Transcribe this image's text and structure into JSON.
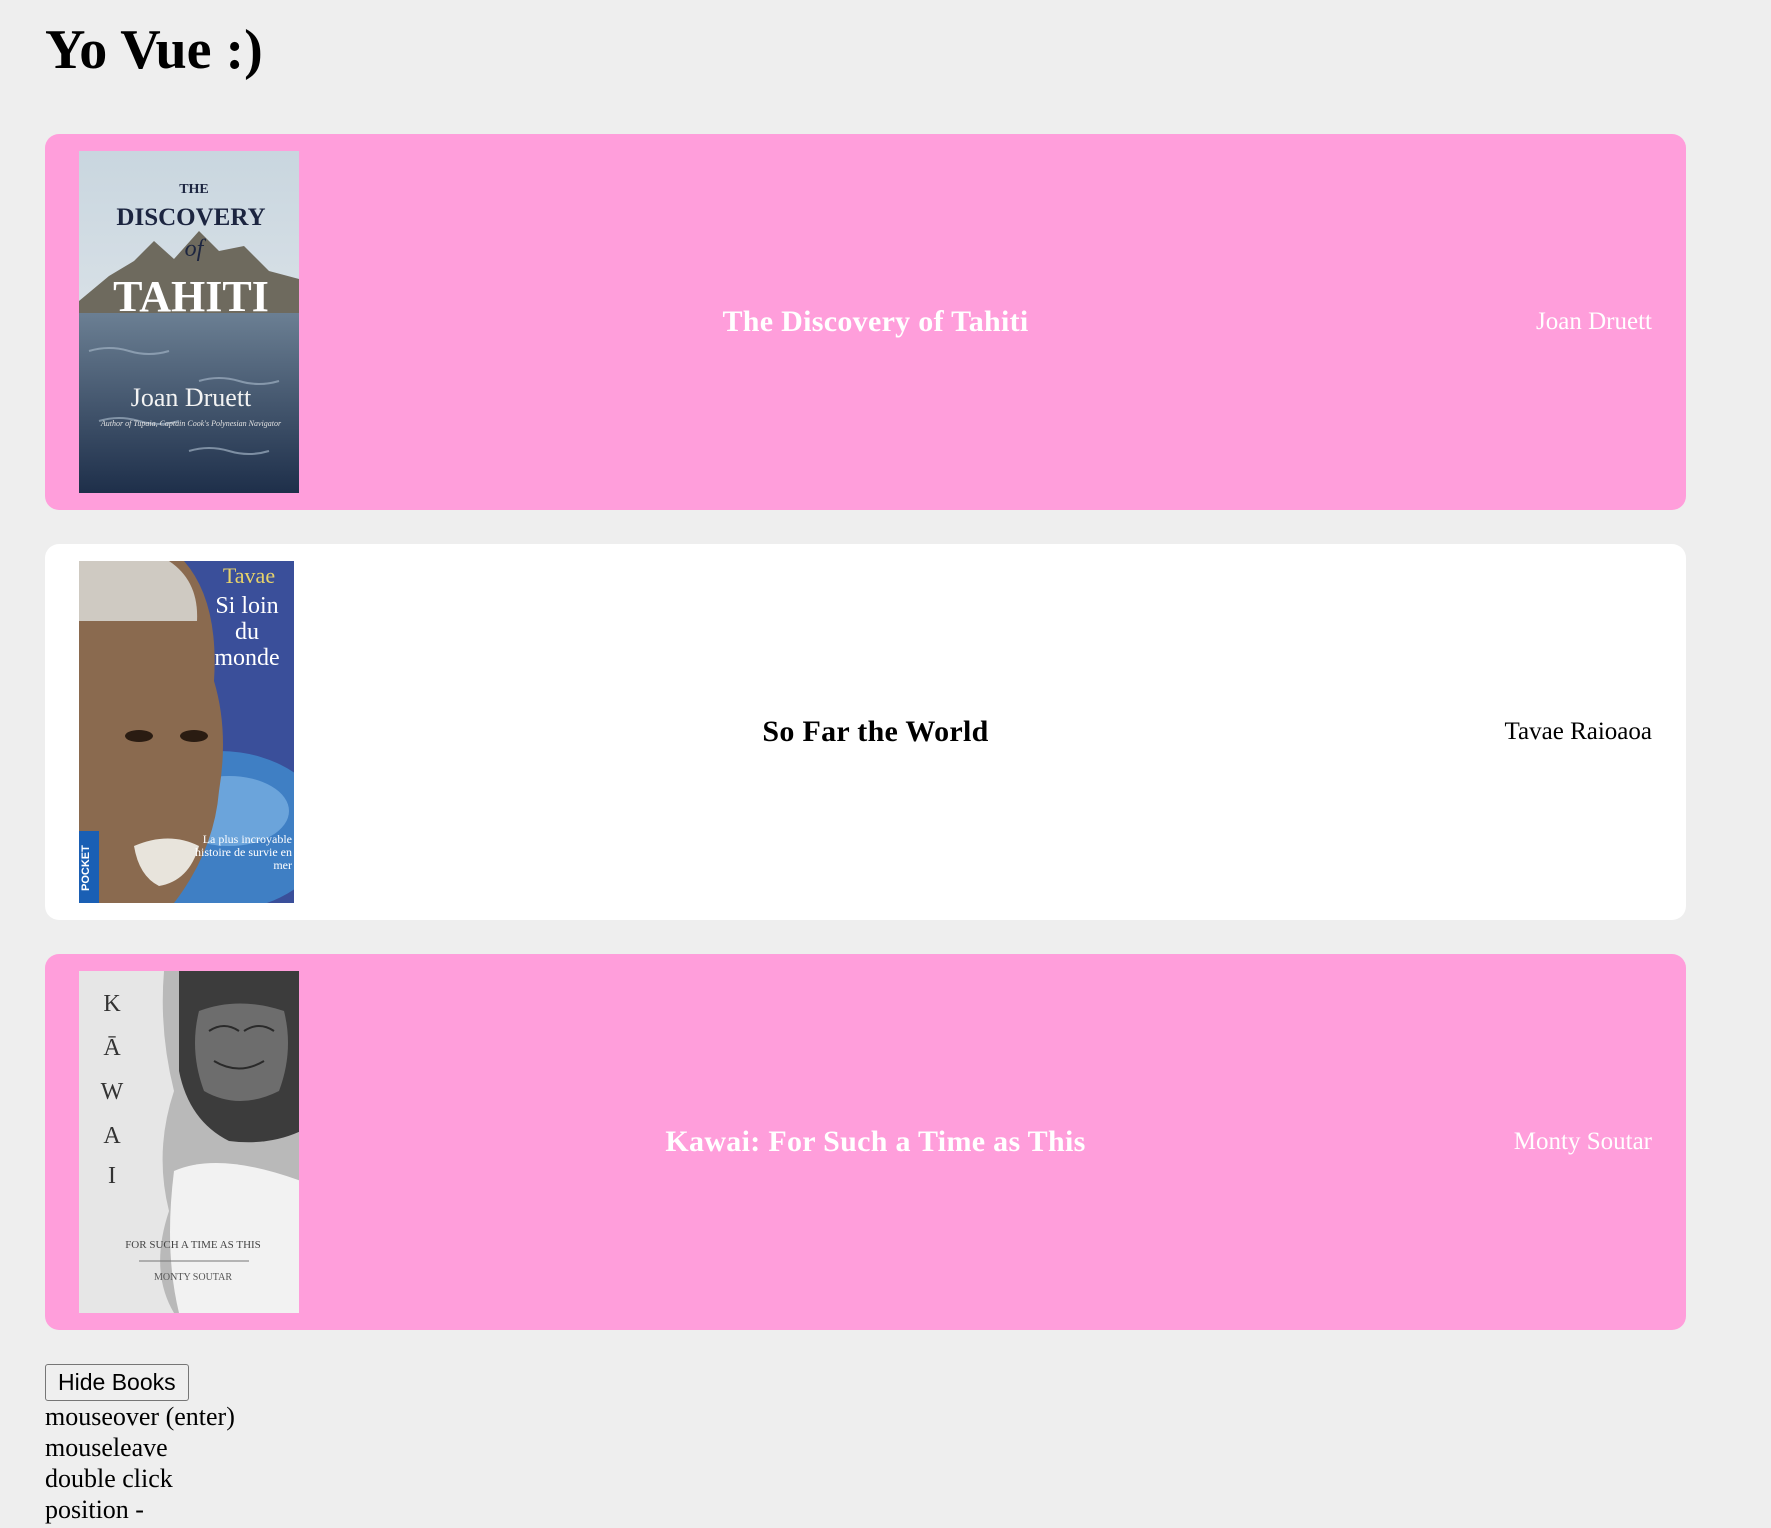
{
  "page": {
    "title": "Yo Vue :)"
  },
  "books": [
    {
      "title": "The Discovery of Tahiti",
      "author": "Joan Druett",
      "favorite": true,
      "cover": {
        "line1": "THE",
        "line2": "DISCOVERY",
        "line3": "of",
        "line4": "TAHITI",
        "line5": "Joan Druett",
        "line6": "Author of Tupaia, Captain Cook's Polynesian Navigator"
      }
    },
    {
      "title": "So Far the World",
      "author": "Tavae Raioaoa",
      "favorite": false,
      "cover": {
        "line1": "Tavae",
        "line2": "Si loin",
        "line3": "du",
        "line4": "monde",
        "line5": "La plus incroyable histoire de survie en mer",
        "line6": "POCKET"
      }
    },
    {
      "title": "Kawai: For Such a Time as This",
      "author": "Monty Soutar",
      "favorite": true,
      "cover": {
        "line1": "K",
        "line2": "Ā",
        "line3": "W",
        "line4": "A",
        "line5": "I",
        "line6": "FOR SUCH A TIME AS THIS",
        "line7": "MONTY SOUTAR"
      }
    }
  ],
  "controls": {
    "toggle_label": "Hide Books"
  },
  "events": {
    "mouseover": "mouseover (enter)",
    "mouseleave": "mouseleave",
    "dblclick": "double click",
    "position": "position -"
  },
  "colors": {
    "favorite_bg": "#ff9edb",
    "plain_bg": "#ffffff",
    "page_bg": "#eeeeee"
  }
}
